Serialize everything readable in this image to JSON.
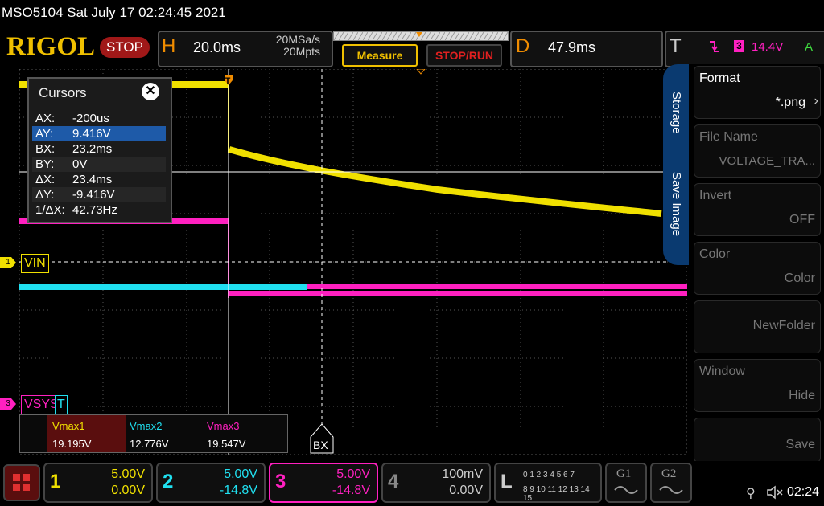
{
  "titlebar": {
    "text": "MSO5104  Sat July 17 02:24:45 2021"
  },
  "header": {
    "logo": "RIGOL",
    "run_state": "STOP",
    "horizontal": {
      "letter": "H",
      "timebase": "20.0ms",
      "sample_rate": "20MSa/s",
      "memory_depth": "20Mpts"
    },
    "measure_label": "Measure",
    "stoprun_label": "STOP/RUN",
    "delay": {
      "letter": "D",
      "value": "47.9ms"
    },
    "trigger": {
      "letter": "T",
      "source": "3",
      "level": "14.4V",
      "mode": "A"
    }
  },
  "cursors": {
    "title": "Cursors",
    "rows": [
      {
        "key": "AX:",
        "value": "-200us"
      },
      {
        "key": "AY:",
        "value": "9.416V"
      },
      {
        "key": "BX:",
        "value": "23.2ms"
      },
      {
        "key": "BY:",
        "value": "0V"
      },
      {
        "key": "ΔX:",
        "value": "23.4ms"
      },
      {
        "key": "ΔY:",
        "value": "-9.416V"
      },
      {
        "key": "1/ΔX:",
        "value": "42.73Hz"
      }
    ]
  },
  "waveform_labels": {
    "vin": "VIN",
    "vsys": "VSYS",
    "t_marker": "T",
    "bx": "BX",
    "ch1_marker": "1",
    "ch3_marker": "3",
    "trig_marker": "T"
  },
  "vmax": [
    {
      "name": "Vmax1",
      "value": "19.195V",
      "color": "#f0e000"
    },
    {
      "name": "Vmax2",
      "value": "12.776V",
      "color": "#20e0f0"
    },
    {
      "name": "Vmax3",
      "value": "19.547V",
      "color": "#ff20c0"
    }
  ],
  "menu": {
    "tabs": [
      "Storage",
      "Save Image"
    ],
    "items": [
      {
        "label": "Format",
        "value": "*.png"
      },
      {
        "label": "File Name",
        "value": "VOLTAGE_TRA..."
      },
      {
        "label": "Invert",
        "value": "OFF"
      },
      {
        "label": "Color",
        "value": "Color"
      },
      {
        "label": "",
        "value": "NewFolder"
      },
      {
        "label": "Window",
        "value": "Hide"
      },
      {
        "label": "",
        "value": "Save"
      }
    ]
  },
  "channels": [
    {
      "num": "1",
      "scale": "5.00V",
      "offset": "0.00V",
      "color": "#f0e000"
    },
    {
      "num": "2",
      "scale": "5.00V",
      "offset": "-14.8V",
      "color": "#20e0f0"
    },
    {
      "num": "3",
      "scale": "5.00V",
      "offset": "-14.8V",
      "color": "#ff20c0"
    },
    {
      "num": "4",
      "scale": "100mV",
      "offset": "0.00V",
      "color": "#888888"
    }
  ],
  "la": {
    "letter": "L",
    "row1": "0 1 2 3  4 5 6 7",
    "row2": "8 9 10 11 12 13 14 15"
  },
  "statusbar": {
    "gen1": "G1",
    "gen2": "G2",
    "time": "02:24"
  },
  "colors": {
    "ch1": "#f0e000",
    "ch2": "#20e0f0",
    "ch3": "#ff20c0",
    "brand": "#f0c000",
    "menu_tab": "#0a3a70"
  }
}
